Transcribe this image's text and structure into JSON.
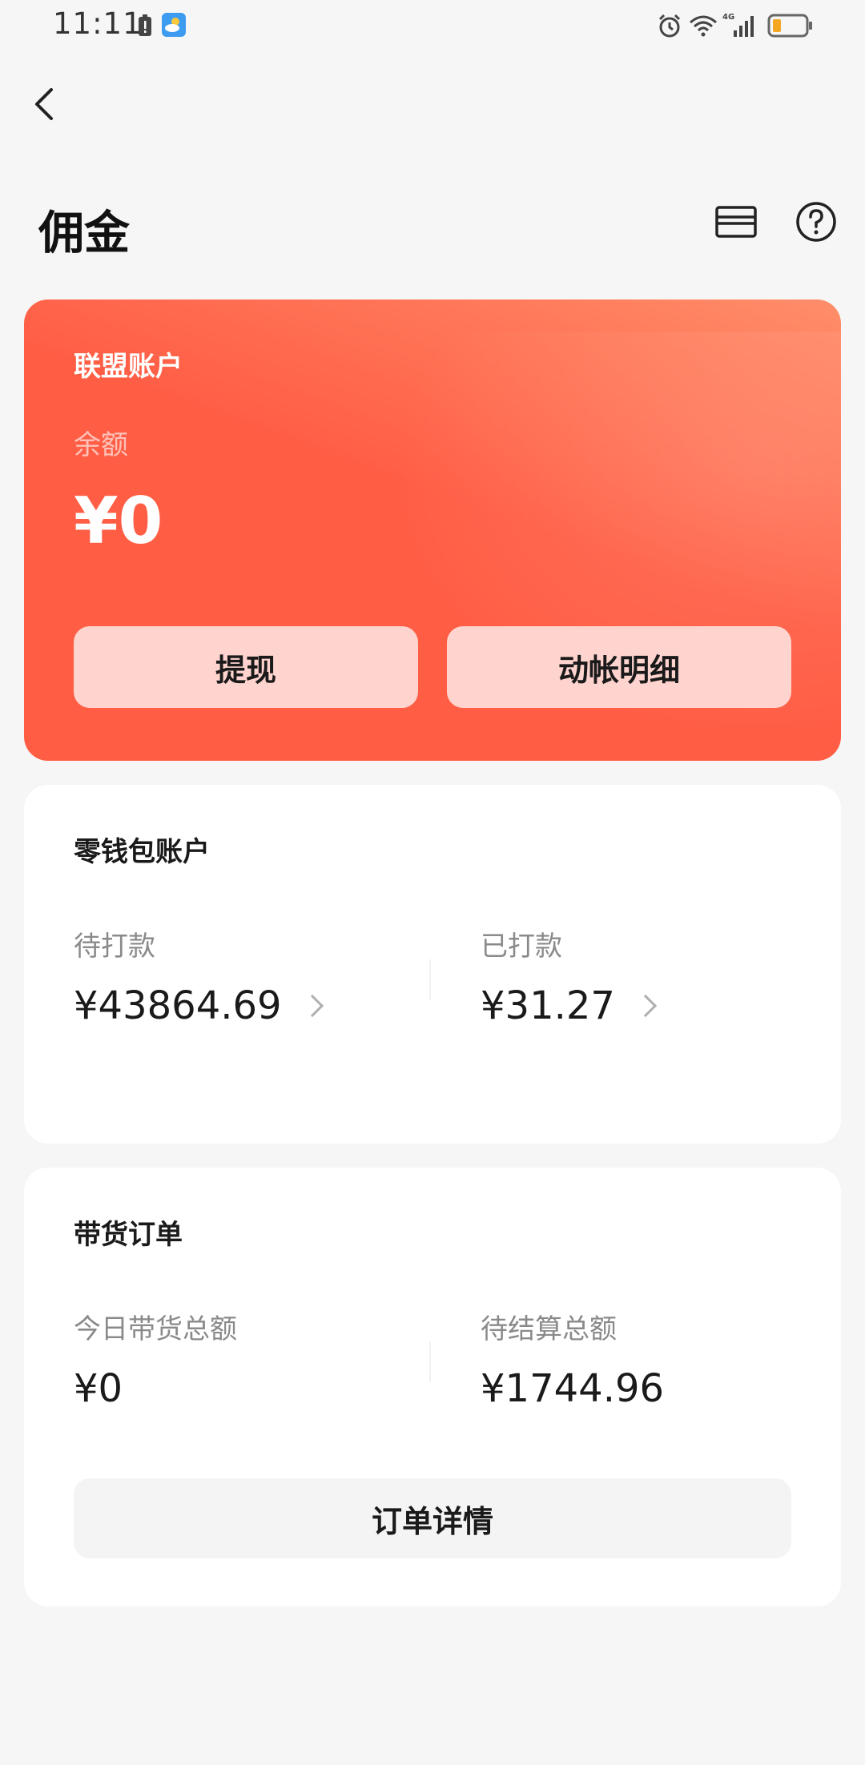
{
  "status_bar": {
    "time": "11:11",
    "icons": [
      "battery-warning-icon",
      "weather-icon",
      "alarm-icon",
      "wifi-icon",
      "signal-4g-icon",
      "battery-icon"
    ]
  },
  "header": {
    "title": "佣金",
    "icons": [
      "back-icon",
      "card-icon",
      "help-icon"
    ]
  },
  "alliance_account": {
    "title": "联盟账户",
    "balance_label": "余额",
    "balance": "¥0",
    "withdraw_label": "提现",
    "details_label": "动帐明细"
  },
  "wallet_account": {
    "title": "零钱包账户",
    "pending_label": "待打款",
    "pending_value": "¥43864.69",
    "paid_label": "已打款",
    "paid_value": "¥31.27"
  },
  "orders": {
    "title": "带货订单",
    "today_label": "今日带货总额",
    "today_value": "¥0",
    "settle_label": "待结算总额",
    "settle_value": "¥1744.96",
    "details_button": "订单详情"
  },
  "colors": {
    "card_gradient_start": "#ff5e45",
    "card_gradient_end": "#ff8e6a",
    "card_button": "#ffd4cf",
    "background": "#f6f6f6"
  }
}
